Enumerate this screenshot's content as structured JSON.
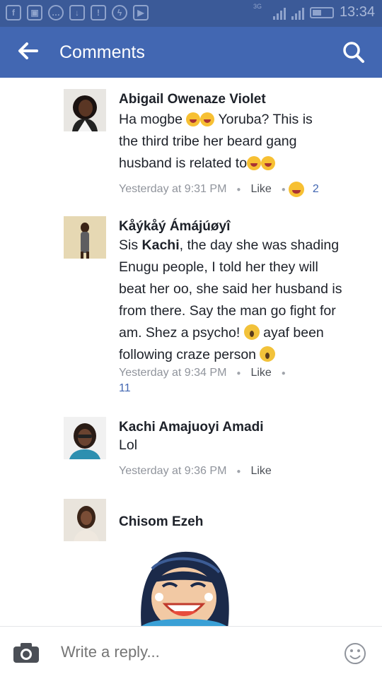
{
  "status_bar": {
    "network": "3G",
    "time": "13:34"
  },
  "app_bar": {
    "title": "Comments"
  },
  "comments": [
    {
      "author": "Abigail Owenaze Violet",
      "lines": [
        "Ha mogbe",
        "Yoruba?  This is",
        "the third tribe her beard gang",
        "husband is related to"
      ],
      "time": "Yesterday at 9:31 PM",
      "like": "Like",
      "reactions": "2"
    },
    {
      "author": "Kåýkåý Ámájúøyî",
      "lines": [
        "Sis ",
        "Kachi",
        ", the day she was shading",
        "Enugu people, I told her they will",
        "beat her oo, she said her husband is",
        "from there. Say the man go fight for",
        "am. Shez a psycho!",
        "ayaf been",
        "following craze person"
      ],
      "time": "Yesterday at 9:34 PM",
      "like": "Like",
      "reactions": "11"
    },
    {
      "author": "Kachi Amajuoyi Amadi",
      "lines": [
        "Lol"
      ],
      "time": "Yesterday at 9:36 PM",
      "like": "Like"
    },
    {
      "author": "Chisom Ezeh"
    }
  ],
  "reply": {
    "placeholder": "Write a reply..."
  },
  "colors": {
    "brand": "#4267b2",
    "status": "#3b5a98"
  }
}
